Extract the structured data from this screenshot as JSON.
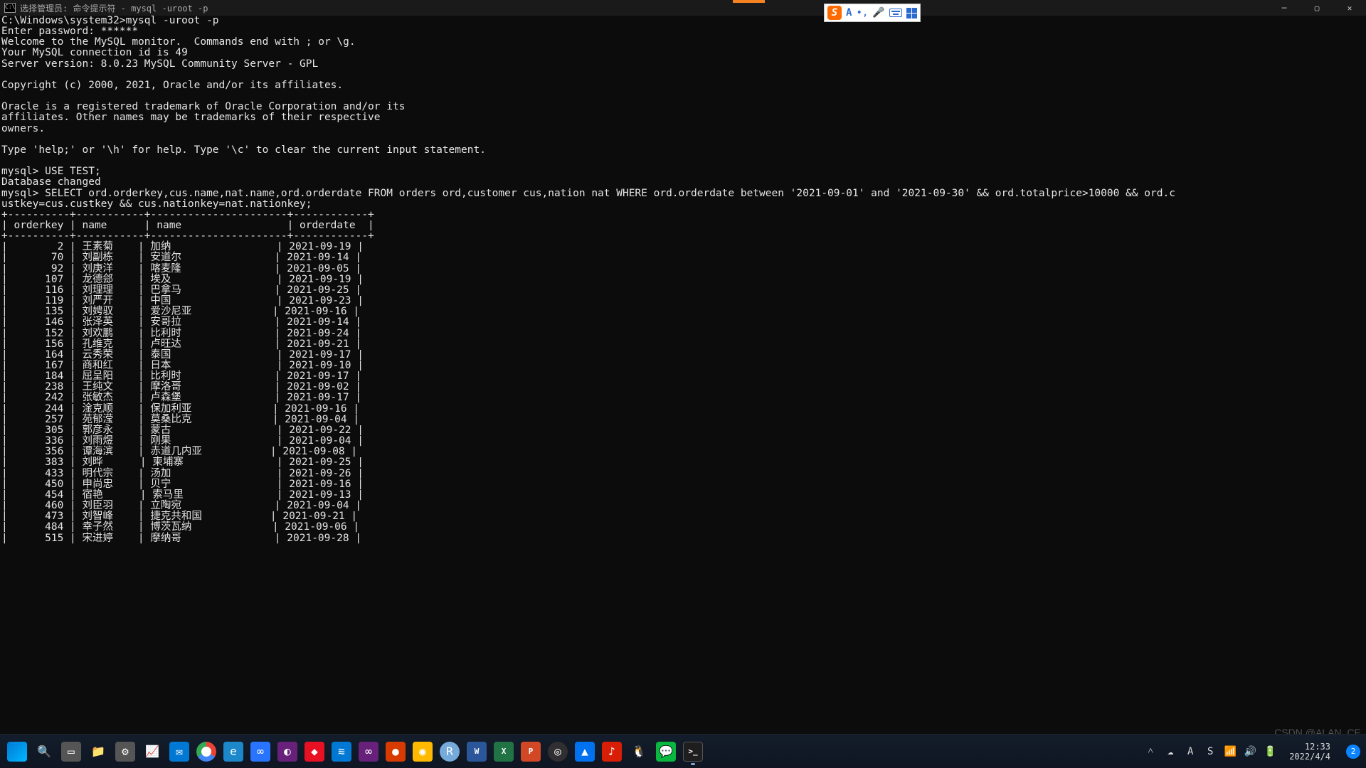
{
  "window": {
    "title": "选择管理员: 命令提示符 - mysql  -uroot -p"
  },
  "ime": {
    "logo_letter": "S",
    "mode_letter": "A",
    "punct": "•,"
  },
  "terminal": {
    "preamble": [
      "C:\\Windows\\system32>mysql -uroot -p",
      "Enter password: ******",
      "Welcome to the MySQL monitor.  Commands end with ; or \\g.",
      "Your MySQL connection id is 49",
      "Server version: 8.0.23 MySQL Community Server - GPL",
      "",
      "Copyright (c) 2000, 2021, Oracle and/or its affiliates.",
      "",
      "Oracle is a registered trademark of Oracle Corporation and/or its",
      "affiliates. Other names may be trademarks of their respective",
      "owners.",
      "",
      "Type 'help;' or '\\h' for help. Type '\\c' to clear the current input statement.",
      "",
      "mysql> USE TEST;",
      "Database changed",
      "mysql> SELECT ord.orderkey,cus.name,nat.name,ord.orderdate FROM orders ord,customer cus,nation nat WHERE ord.orderdate between '2021-09-01' and '2021-09-30' && ord.totalprice>10000 && ord.c",
      "ustkey=cus.custkey && cus.nationkey=nat.nationkey;"
    ],
    "columns": [
      "orderkey",
      "name",
      "name",
      "orderdate"
    ],
    "rows": [
      {
        "orderkey": 2,
        "cus_name": "王素菊",
        "nat_name": "加纳",
        "orderdate": "2021-09-19"
      },
      {
        "orderkey": 70,
        "cus_name": "刘副栋",
        "nat_name": "安道尔",
        "orderdate": "2021-09-14"
      },
      {
        "orderkey": 92,
        "cus_name": "刘庚洋",
        "nat_name": "喀麦隆",
        "orderdate": "2021-09-05"
      },
      {
        "orderkey": 107,
        "cus_name": "龙德郐",
        "nat_name": "埃及",
        "orderdate": "2021-09-19"
      },
      {
        "orderkey": 116,
        "cus_name": "刘理理",
        "nat_name": "巴拿马",
        "orderdate": "2021-09-25"
      },
      {
        "orderkey": 119,
        "cus_name": "刘严开",
        "nat_name": "中国",
        "orderdate": "2021-09-23"
      },
      {
        "orderkey": 135,
        "cus_name": "刘娉驭",
        "nat_name": "爱沙尼亚",
        "orderdate": "2021-09-16"
      },
      {
        "orderkey": 146,
        "cus_name": "张泽英",
        "nat_name": "安哥拉",
        "orderdate": "2021-09-14"
      },
      {
        "orderkey": 152,
        "cus_name": "刘欢鹏",
        "nat_name": "比利时",
        "orderdate": "2021-09-24"
      },
      {
        "orderkey": 156,
        "cus_name": "孔维克",
        "nat_name": "卢旺达",
        "orderdate": "2021-09-21"
      },
      {
        "orderkey": 164,
        "cus_name": "云秀荣",
        "nat_name": "泰国",
        "orderdate": "2021-09-17"
      },
      {
        "orderkey": 167,
        "cus_name": "商和红",
        "nat_name": "日本",
        "orderdate": "2021-09-10"
      },
      {
        "orderkey": 184,
        "cus_name": "屈呈阳",
        "nat_name": "比利时",
        "orderdate": "2021-09-17"
      },
      {
        "orderkey": 238,
        "cus_name": "王纯文",
        "nat_name": "摩洛哥",
        "orderdate": "2021-09-02"
      },
      {
        "orderkey": 242,
        "cus_name": "张敏杰",
        "nat_name": "卢森堡",
        "orderdate": "2021-09-17"
      },
      {
        "orderkey": 244,
        "cus_name": "淦克顺",
        "nat_name": "保加利亚",
        "orderdate": "2021-09-16"
      },
      {
        "orderkey": 257,
        "cus_name": "苑郁滢",
        "nat_name": "莫桑比克",
        "orderdate": "2021-09-04"
      },
      {
        "orderkey": 305,
        "cus_name": "郭彦永",
        "nat_name": "蒙古",
        "orderdate": "2021-09-22"
      },
      {
        "orderkey": 336,
        "cus_name": "刘雨煜",
        "nat_name": "刚果",
        "orderdate": "2021-09-04"
      },
      {
        "orderkey": 356,
        "cus_name": "谭海滨",
        "nat_name": "赤道几内亚",
        "orderdate": "2021-09-08"
      },
      {
        "orderkey": 383,
        "cus_name": "刘晔",
        "nat_name": "柬埔寨",
        "orderdate": "2021-09-25"
      },
      {
        "orderkey": 433,
        "cus_name": "明代宗",
        "nat_name": "汤加",
        "orderdate": "2021-09-26"
      },
      {
        "orderkey": 450,
        "cus_name": "申尚忠",
        "nat_name": "贝宁",
        "orderdate": "2021-09-16"
      },
      {
        "orderkey": 454,
        "cus_name": "宿艳",
        "nat_name": "索马里",
        "orderdate": "2021-09-13"
      },
      {
        "orderkey": 460,
        "cus_name": "刘臣羽",
        "nat_name": "立陶宛",
        "orderdate": "2021-09-04"
      },
      {
        "orderkey": 473,
        "cus_name": "刘智峰",
        "nat_name": "捷克共和国",
        "orderdate": "2021-09-21"
      },
      {
        "orderkey": 484,
        "cus_name": "幸子然",
        "nat_name": "博茨瓦纳",
        "orderdate": "2021-09-06"
      },
      {
        "orderkey": 515,
        "cus_name": "宋进婷",
        "nat_name": "摩纳哥",
        "orderdate": "2021-09-28"
      }
    ]
  },
  "taskbar": {
    "apps": [
      {
        "name": "start-button",
        "cls": "win-start"
      },
      {
        "name": "search-icon",
        "txt": "🔍",
        "cls": "bg-trans"
      },
      {
        "name": "task-view-icon",
        "txt": "▭",
        "cls": "bg-gray"
      },
      {
        "name": "file-explorer-icon",
        "txt": "📁",
        "cls": ""
      },
      {
        "name": "settings-icon",
        "txt": "⚙",
        "cls": "bg-gray"
      },
      {
        "name": "chart-app-icon",
        "txt": "📈",
        "cls": ""
      },
      {
        "name": "mail-app-icon",
        "txt": "✉",
        "cls": "bg-blue"
      },
      {
        "name": "chrome-icon",
        "txt": "",
        "cls": "bg-chrome"
      },
      {
        "name": "edge-icon",
        "txt": "e",
        "cls": "bg-edge"
      },
      {
        "name": "baidu-netdisk-icon",
        "txt": "∞",
        "cls": "bg-baidu"
      },
      {
        "name": "quark-icon",
        "txt": "◐",
        "cls": "bg-purple"
      },
      {
        "name": "todesk-icon",
        "txt": "◆",
        "cls": "bg-red"
      },
      {
        "name": "vscode-icon",
        "txt": "≋",
        "cls": "bg-blue"
      },
      {
        "name": "visual-studio-icon",
        "txt": "∞",
        "cls": "bg-purple"
      },
      {
        "name": "jupyter-icon",
        "txt": "●",
        "cls": "bg-orange"
      },
      {
        "name": "pycharm-icon",
        "txt": "◉",
        "cls": "bg-yellow"
      },
      {
        "name": "rstudio-icon",
        "txt": "R",
        "cls": "bg-rstudio"
      },
      {
        "name": "word-icon",
        "txt": "W",
        "cls": "bg-word small-txt"
      },
      {
        "name": "excel-icon",
        "txt": "X",
        "cls": "bg-excel small-txt"
      },
      {
        "name": "powerpoint-icon",
        "txt": "P",
        "cls": "bg-ppt small-txt"
      },
      {
        "name": "obs-icon",
        "txt": "◎",
        "cls": "bg-obs"
      },
      {
        "name": "todesk2-icon",
        "txt": "▲",
        "cls": "bg-todesk"
      },
      {
        "name": "netease-music-icon",
        "txt": "♪",
        "cls": "bg-netease"
      },
      {
        "name": "qq-icon",
        "txt": "🐧",
        "cls": ""
      },
      {
        "name": "wechat-icon",
        "txt": "💬",
        "cls": "bg-wechat"
      },
      {
        "name": "terminal-icon",
        "txt": ">_",
        "cls": "bg-term small-txt",
        "active": true
      }
    ]
  },
  "systray": {
    "items": [
      {
        "name": "tray-overflow-icon",
        "txt": "˄"
      },
      {
        "name": "onedrive-icon",
        "txt": "☁"
      },
      {
        "name": "ime-letter-icon",
        "txt": "A"
      },
      {
        "name": "sogou-tray-icon",
        "txt": "S"
      },
      {
        "name": "wifi-icon",
        "txt": "📶"
      },
      {
        "name": "volume-icon",
        "txt": "🔊"
      },
      {
        "name": "battery-icon",
        "txt": "🔋"
      }
    ],
    "clock_time": "12:33",
    "clock_date": "2022/4/4",
    "notif_count": "2"
  },
  "watermark": "CSDN @ALAN_CF"
}
